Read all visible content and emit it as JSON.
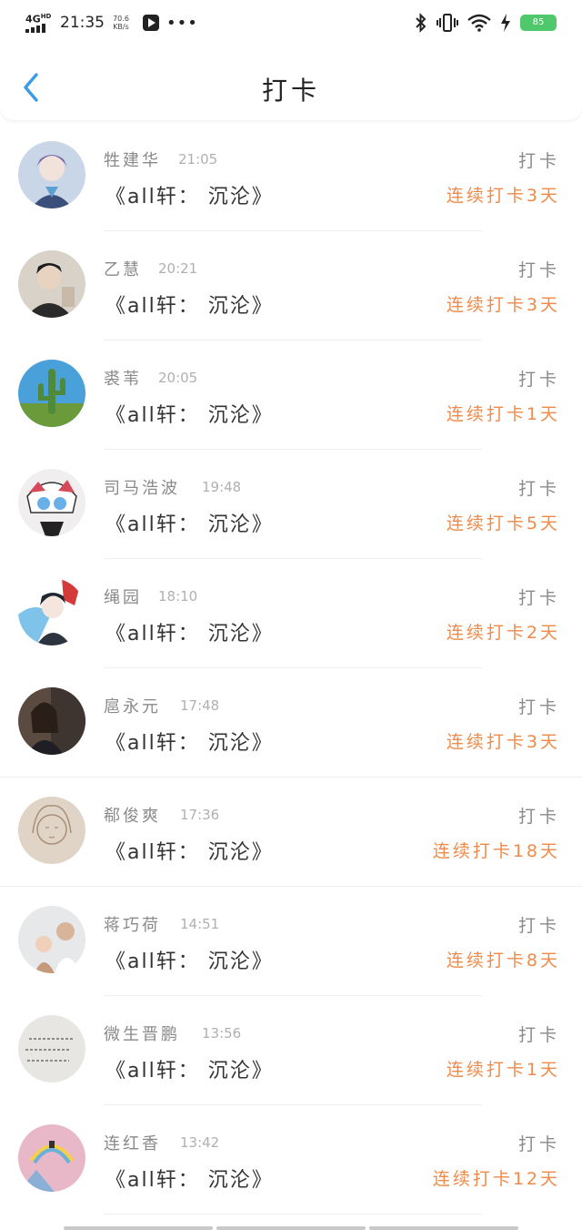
{
  "status_bar": {
    "network": "4G",
    "network_sup": "HD",
    "time": "21:35",
    "speed_value": "70.6",
    "speed_unit": "KB/s",
    "more": "•••",
    "battery": "85"
  },
  "header": {
    "title": "打卡"
  },
  "checkins": [
    {
      "name": "牲建华",
      "time": "21:05",
      "book": "《all轩： 沉沦》",
      "action": "打卡",
      "streak": "连续打卡3天",
      "avatar_color": "#c9d6e8",
      "avatar_accent": "#7a6aa8"
    },
    {
      "name": "乙慧",
      "time": "20:21",
      "book": "《all轩： 沉沦》",
      "action": "打卡",
      "streak": "连续打卡3天",
      "avatar_color": "#d8d2c8",
      "avatar_accent": "#2a2a2a"
    },
    {
      "name": "裘苇",
      "time": "20:05",
      "book": "《all轩： 沉沦》",
      "action": "打卡",
      "streak": "连续打卡1天",
      "avatar_color": "#4aa0d8",
      "avatar_accent": "#4f8a3a"
    },
    {
      "name": "司马浩波",
      "time": "19:48",
      "book": "《all轩： 沉沦》",
      "action": "打卡",
      "streak": "连续打卡5天",
      "avatar_color": "#f1eef0",
      "avatar_accent": "#d44a5a"
    },
    {
      "name": "绳园",
      "time": "18:10",
      "book": "《all轩： 沉沦》",
      "action": "打卡",
      "streak": "连续打卡2天",
      "avatar_color": "#7fc3ea",
      "avatar_accent": "#2c3440"
    },
    {
      "name": "扈永元",
      "time": "17:48",
      "book": "《all轩： 沉沦》",
      "action": "打卡",
      "streak": "连续打卡3天",
      "avatar_color": "#5a4a40",
      "avatar_accent": "#1e1e24"
    },
    {
      "name": "郗俊爽",
      "time": "17:36",
      "book": "《all轩： 沉沦》",
      "action": "打卡",
      "streak": "连续打卡18天",
      "avatar_color": "#e0d4c6",
      "avatar_accent": "#a89078"
    },
    {
      "name": "蒋巧荷",
      "time": "14:51",
      "book": "《all轩： 沉沦》",
      "action": "打卡",
      "streak": "连续打卡8天",
      "avatar_color": "#e6e8ea",
      "avatar_accent": "#c49a7a"
    },
    {
      "name": "微生晋鹏",
      "time": "13:56",
      "book": "《all轩： 沉沦》",
      "action": "打卡",
      "streak": "连续打卡1天",
      "avatar_color": "#e8e6e2",
      "avatar_accent": "#555555"
    },
    {
      "name": "连红香",
      "time": "13:42",
      "book": "《all轩： 沉沦》",
      "action": "打卡",
      "streak": "连续打卡12天",
      "avatar_color": "#e9b8c8",
      "avatar_accent": "#6ab0d8"
    }
  ]
}
